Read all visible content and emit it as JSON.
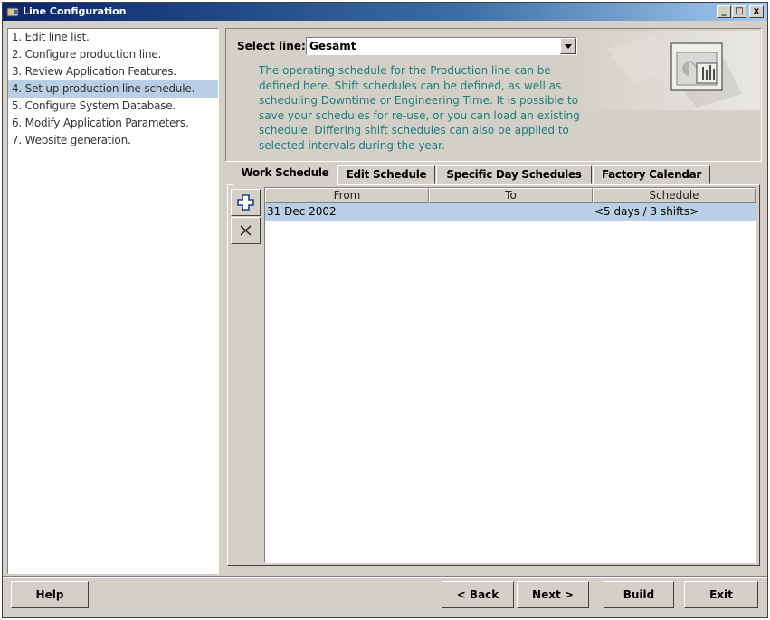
{
  "window": {
    "title": "Line Configuration",
    "controls": {
      "minimize": "_",
      "maximize": "□",
      "close": "x"
    }
  },
  "steps": [
    {
      "label": "1. Edit line list."
    },
    {
      "label": "2. Configure production line."
    },
    {
      "label": "3. Review Application Features."
    },
    {
      "label": "4. Set up production line schedule.",
      "selected": true
    },
    {
      "label": "5. Configure System Database."
    },
    {
      "label": "6. Modify Application Parameters."
    },
    {
      "label": "7. Website generation."
    }
  ],
  "header": {
    "select_label": "Select line:",
    "select_value": "Gesamt",
    "description": "The operating schedule for the Production line can be defined here. Shift schedules can be defined, as well as scheduling Downtime or Engineering Time. It is possible to save your schedules for re-use, or you can load an existing schedule. Differing shift schedules can also be applied to selected intervals during the year.",
    "accent_color": "#1b7d7d"
  },
  "tabs": [
    {
      "label": "Work Schedule",
      "active": true
    },
    {
      "label": "Edit Schedule"
    },
    {
      "label": "Specific Day Schedules"
    },
    {
      "label": "Factory Calendar"
    }
  ],
  "toolbar": {
    "add_icon": "plus-icon",
    "delete_icon": "close-icon"
  },
  "table": {
    "columns": [
      "From",
      "To",
      "Schedule"
    ],
    "rows": [
      {
        "from": "31 Dec 2002",
        "to": "",
        "schedule": "<5 days / 3 shifts>"
      }
    ],
    "selection_color": "#b8cfe5"
  },
  "buttons": {
    "help": "Help",
    "back": "< Back",
    "next": "Next >",
    "build": "Build",
    "exit": "Exit"
  }
}
